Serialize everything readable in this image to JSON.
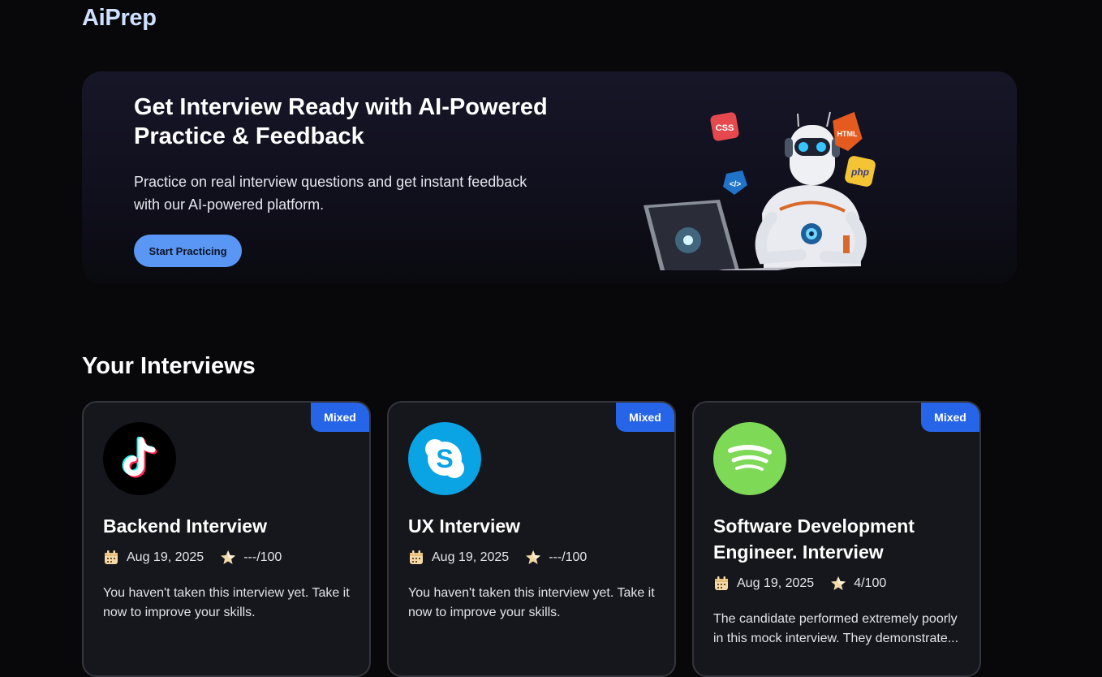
{
  "brand": {
    "name": "AiPrep"
  },
  "hero": {
    "title": "Get Interview Ready with AI-Powered Practice & Feedback",
    "subtitle": "Practice on real interview questions and get instant feedback with our AI-powered platform.",
    "cta_label": "Start Practicing",
    "art_tags": [
      "CSS",
      "HTML",
      "</>",
      "php"
    ]
  },
  "interviews": {
    "heading": "Your Interviews",
    "cards": [
      {
        "type_badge": "Mixed",
        "logo": "tiktok-logo",
        "title": "Backend Interview",
        "date": "Aug 19, 2025",
        "score": "---/100",
        "description": "You haven't taken this interview yet. Take it now to improve your skills."
      },
      {
        "type_badge": "Mixed",
        "logo": "skype-logo",
        "title": "UX Interview",
        "date": "Aug 19, 2025",
        "score": "---/100",
        "description": "You haven't taken this interview yet. Take it now to improve your skills."
      },
      {
        "type_badge": "Mixed",
        "logo": "spotify-logo",
        "title": "Software Development Engineer. Interview",
        "date": "Aug 19, 2025",
        "score": "4/100",
        "description": "The candidate performed extremely poorly in this mock interview. They demonstrate..."
      }
    ]
  },
  "colors": {
    "background": "#08080a",
    "accent": "#5a97f5",
    "badge": "#2765e8",
    "card": "#16171c"
  },
  "icons": {
    "date": "calendar-icon",
    "score": "star-icon"
  }
}
